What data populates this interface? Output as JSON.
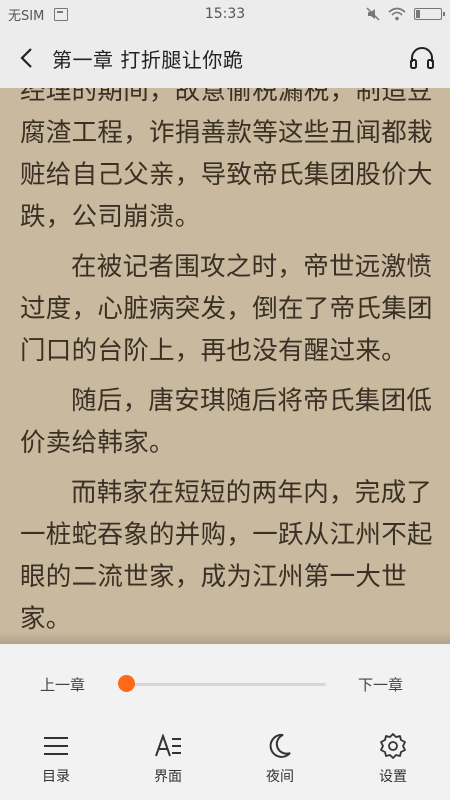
{
  "status_bar": {
    "carrier": "无SIM",
    "time": "15:33"
  },
  "header": {
    "title": "第一章 打折腿让你跪"
  },
  "content": {
    "paragraphs": [
      "经理的期间，故意偷税漏税，制造豆腐渣工程，诈捐善款等这些丑闻都栽赃给自己父亲，导致帝氏集团股价大跌，公司崩溃。",
      "在被记者围攻之时，帝世远激愤过度，心脏病突发，倒在了帝氏集团门口的台阶上，再也没有醒过来。",
      "随后，唐安琪随后将帝氏集团低价卖给韩家。",
      "而韩家在短短的两年内，完成了一桩蛇吞象的并购，一跃从江州不起眼的二流世家，成为江州第一大世家。"
    ]
  },
  "reader_panel": {
    "prev_chapter": "上一章",
    "next_chapter": "下一章",
    "progress": 0.0,
    "accent_color": "#ff6a1a",
    "tools": [
      {
        "label": "目录",
        "icon": "list-icon"
      },
      {
        "label": "界面",
        "icon": "font-style-icon"
      },
      {
        "label": "夜间",
        "icon": "moon-icon"
      },
      {
        "label": "设置",
        "icon": "gear-icon"
      }
    ]
  }
}
